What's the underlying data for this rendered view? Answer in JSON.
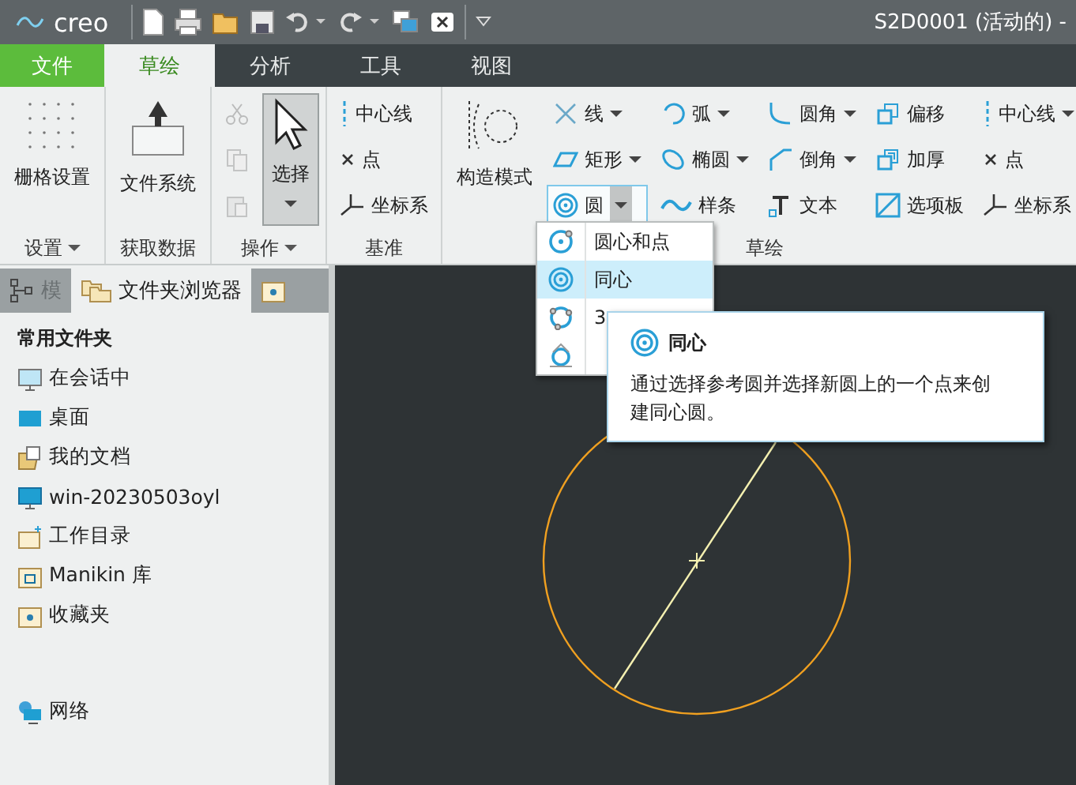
{
  "title_bar": {
    "logo": "creo",
    "title": "S2D0001 (活动的) -"
  },
  "menu_tabs": [
    {
      "label": "文件",
      "kind": "file",
      "selected": false
    },
    {
      "label": "草绘",
      "kind": "tab",
      "selected": true
    },
    {
      "label": "分析",
      "kind": "tab",
      "selected": false
    },
    {
      "label": "工具",
      "kind": "tab",
      "selected": false
    },
    {
      "label": "视图",
      "kind": "tab",
      "selected": false
    }
  ],
  "ribbon": {
    "groups": [
      {
        "label": "设置",
        "menu": true,
        "tools": [
          {
            "kind": "grid",
            "label": "栅格设置"
          }
        ]
      },
      {
        "label": "获取数据",
        "menu": false,
        "tools": [
          {
            "kind": "file_system",
            "label": "文件系统"
          }
        ]
      },
      {
        "label": "操作",
        "menu": true,
        "tools": [
          {
            "kind": "column",
            "items": [
              {
                "kind": "cut",
                "disabled": true
              },
              {
                "kind": "copy",
                "disabled": true
              },
              {
                "kind": "paste",
                "disabled": true
              }
            ]
          },
          {
            "kind": "select",
            "label": "选择",
            "pressed": true,
            "menu": true
          }
        ]
      },
      {
        "label": "基准",
        "menu": false,
        "tools": [
          {
            "kind": "column",
            "items": [
              {
                "kind": "centerline",
                "label": "中心线"
              },
              {
                "kind": "point",
                "label": "点"
              },
              {
                "kind": "csys",
                "label": "坐标系"
              }
            ]
          }
        ]
      },
      {
        "label": "草绘",
        "menu": false,
        "tools": [
          {
            "kind": "construction",
            "label": "构造模式"
          },
          {
            "kind": "column",
            "items": [
              {
                "kind": "line",
                "label": "线",
                "menu": true
              },
              {
                "kind": "rectangle",
                "label": "矩形",
                "menu": true
              },
              {
                "kind": "circle",
                "label": "圆",
                "menu": true,
                "open": true
              }
            ]
          },
          {
            "kind": "column",
            "items": [
              {
                "kind": "arc",
                "label": "弧",
                "menu": true
              },
              {
                "kind": "ellipse",
                "label": "椭圆",
                "menu": true
              },
              {
                "kind": "spline",
                "label": "样条",
                "menu": false
              }
            ]
          },
          {
            "kind": "column",
            "items": [
              {
                "kind": "fillet",
                "label": "圆角",
                "menu": true
              },
              {
                "kind": "chamfer",
                "label": "倒角",
                "menu": true
              },
              {
                "kind": "text",
                "label": "文本",
                "menu": false
              }
            ]
          },
          {
            "kind": "column",
            "items": [
              {
                "kind": "offset",
                "label": "偏移",
                "menu": false
              },
              {
                "kind": "thicken",
                "label": "加厚",
                "menu": false
              },
              {
                "kind": "palette",
                "label": "选项板",
                "menu": false
              }
            ]
          },
          {
            "kind": "column",
            "items": [
              {
                "kind": "centerline",
                "label": "中心线",
                "menu": true
              },
              {
                "kind": "point",
                "label": "点",
                "menu": false
              },
              {
                "kind": "csys",
                "label": "坐标系",
                "menu": false
              }
            ]
          }
        ]
      }
    ]
  },
  "circle_menu": {
    "items": [
      {
        "kind": "center_point",
        "label": "圆心和点",
        "selected": false
      },
      {
        "kind": "concentric",
        "label": "同心",
        "selected": true
      },
      {
        "kind": "three_point",
        "label": "3",
        "selected": false
      },
      {
        "kind": "tangent",
        "selected": false
      }
    ]
  },
  "tooltip": {
    "title": "同心",
    "text": "通过选择参考圆并选择新圆上的一个点来创建同心圆。"
  },
  "side_panel": {
    "tabs": [
      {
        "kind": "model_tree",
        "label": "模",
        "selected": false
      },
      {
        "kind": "folder_browser",
        "label": "文件夹浏览器",
        "selected": true
      },
      {
        "kind": "favorites",
        "selected": false
      }
    ],
    "heading": "常用文件夹",
    "items": [
      {
        "kind": "session",
        "label": "在会话中"
      },
      {
        "kind": "desktop",
        "label": "桌面"
      },
      {
        "kind": "documents",
        "label": "我的文档"
      },
      {
        "kind": "computer",
        "label": "win-20230503oyl"
      },
      {
        "kind": "workdir",
        "label": "工作目录"
      },
      {
        "kind": "library",
        "label": "Manikin 库"
      },
      {
        "kind": "favorites",
        "label": "收藏夹"
      },
      {
        "kind": "network",
        "label": "网络"
      }
    ]
  }
}
